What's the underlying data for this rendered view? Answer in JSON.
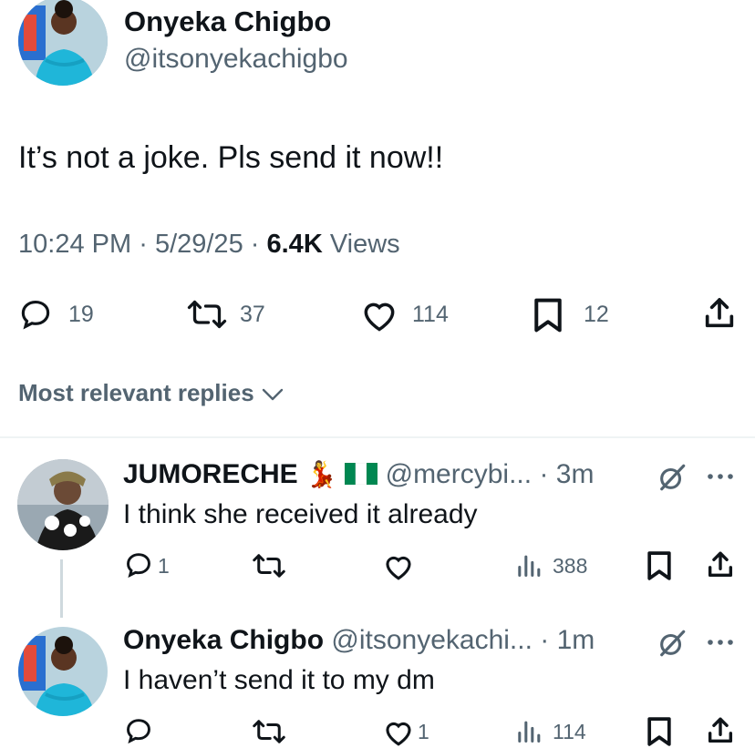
{
  "tweet": {
    "author_name": "Onyeka Chigbo",
    "author_handle": "@itsonyekachigbo",
    "text": "It’s not a joke. Pls send it now!!",
    "time": "10:24 PM",
    "sep1": "·",
    "date": "5/29/25",
    "sep2": "·",
    "views_count": "6.4K",
    "views_label": "Views",
    "replies": "19",
    "reposts": "37",
    "likes": "114",
    "bookmarks": "12"
  },
  "replies_header": {
    "label": "Most relevant replies"
  },
  "replies": [
    {
      "name": "JUMORECHE",
      "emoji": "💃",
      "handle": "@mercybi...",
      "time": "· 3m",
      "text": "I think she received it already",
      "reply_count": "1",
      "like_count": "",
      "views": "388"
    },
    {
      "name": "Onyeka Chigbo",
      "handle": "@itsonyekachi...",
      "time": "· 1m",
      "text": "I haven’t send it to my dm",
      "reply_count": "",
      "like_count": "1",
      "views": "114"
    }
  ],
  "colors": {
    "text": "#0f1419",
    "muted": "#536471",
    "divider": "#eff3f4",
    "avatar_dress": "#1fb6d9"
  },
  "icons": [
    "reply-icon",
    "repost-icon",
    "like-icon",
    "bookmark-icon",
    "share-icon",
    "views-icon",
    "grok-icon",
    "more-icon",
    "flag-nigeria-icon"
  ]
}
